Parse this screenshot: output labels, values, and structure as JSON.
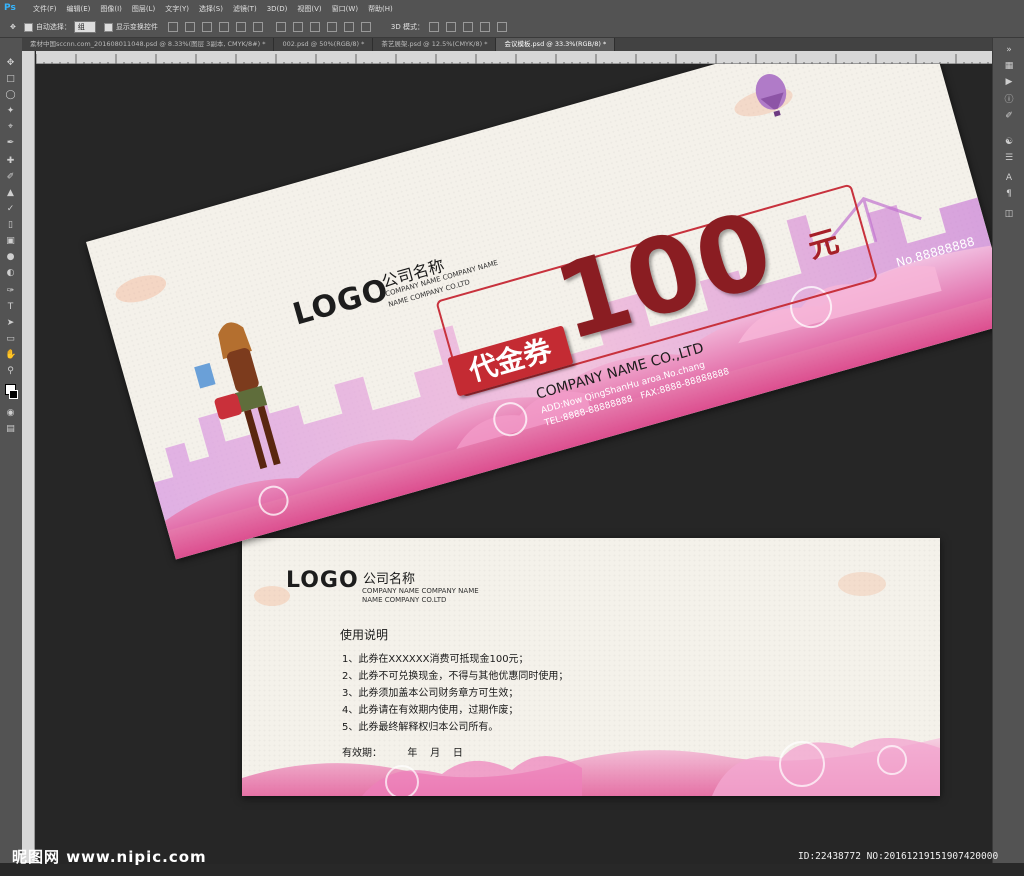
{
  "menubar": {
    "app_logo": "Ps",
    "items": [
      "文件(F)",
      "编辑(E)",
      "图像(I)",
      "图层(L)",
      "文字(Y)",
      "选择(S)",
      "滤镜(T)",
      "3D(D)",
      "视图(V)",
      "窗口(W)",
      "帮助(H)"
    ]
  },
  "options": {
    "auto_select_label": "自动选择：",
    "auto_select_value": "组",
    "show_transform_label": "显示变换控件",
    "mode_3d_label": "3D 模式："
  },
  "tabs": [
    {
      "label": "素材中国sccnn.com_201608011048.psd @ 8.33%(图层 3副本, CMYK/8#) *"
    },
    {
      "label": "002.psd @ 50%(RGB/8) *"
    },
    {
      "label": "茶艺展架.psd @ 12.5%(CMYK/8) *"
    },
    {
      "label": "会议模板.psd @ 33.3%(RGB/8) *"
    }
  ],
  "front": {
    "logo": "LOGO",
    "company_cn": "公司名称",
    "company_en_line1": "COMPANY NAME COMPANY NAME",
    "company_en_line2": "NAME COMPANY CO.LTD",
    "amount": "100",
    "currency": "元",
    "badge": "代金券",
    "serial": "No.88888888",
    "company_name": "COMPANY NAME CO.,LTD",
    "address": "ADD:Now QingShanHu aroa.No.chang",
    "tel_fax": "TEL:8888-88888888   FAX:8888-88888888"
  },
  "back": {
    "logo": "LOGO",
    "company_cn": "公司名称",
    "company_en_line1": "COMPANY NAME COMPANY NAME",
    "company_en_line2": "NAME COMPANY CO.LTD",
    "usage_title": "使用说明",
    "rules": [
      "1、此券在XXXXXX消费可抵现金100元；",
      "2、此券不可兑换现金，不得与其他优惠同时使用；",
      "3、此券须加盖本公司财务章方可生效；",
      "4、此券请在有效期内使用，过期作废；",
      "5、此券最终解释权归本公司所有。"
    ],
    "validity": "有效期：        年    月    日"
  },
  "watermark": {
    "left": "昵图网 www.nipic.com",
    "right": "ID:22438772 NO:20161219151907420000"
  }
}
